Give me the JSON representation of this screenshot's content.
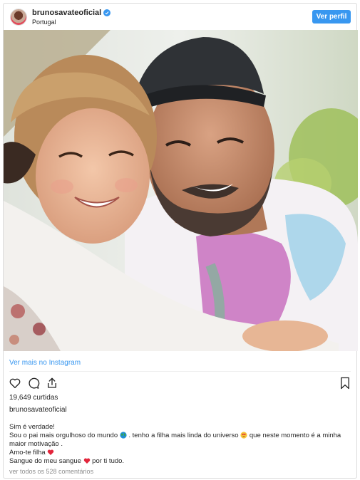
{
  "header": {
    "username": "brunosavateoficial",
    "location": "Portugal",
    "profile_button": "Ver perfil"
  },
  "photo": {
    "description_icon": "post-photo"
  },
  "view_more": "Ver mais no Instagram",
  "actions": {
    "like_icon": "heart-icon",
    "comment_icon": "comment-icon",
    "share_icon": "share-icon",
    "save_icon": "bookmark-icon"
  },
  "likes": "19,649 curtidas",
  "caption_username": "brunosavateoficial",
  "caption": {
    "line1": "Sim é verdade!",
    "line2a": "Sou o pai mais orgulhoso do mundo",
    "line2b": ". tenho a filha mais linda do universo",
    "line2c": "que neste momento é a minha",
    "line3": "maior motivação .",
    "line4": "Amo-te filha",
    "line5a": "Sangue do meu sangue",
    "line5b": "por ti tudo."
  },
  "comments_link": "ver todos os 528 comentários",
  "colors": {
    "accent": "#3897f0",
    "text": "#262626",
    "muted": "#8e8e8e",
    "heart": "#ed4956"
  }
}
